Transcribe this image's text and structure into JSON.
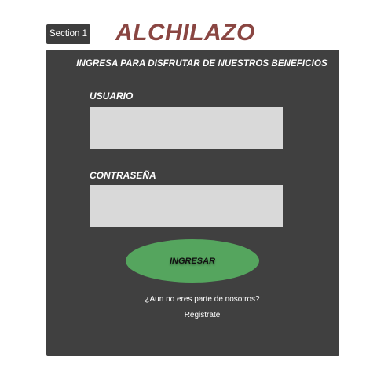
{
  "header": {
    "section_label": "Section 1",
    "brand": "ALCHILAZO"
  },
  "login": {
    "heading": "INGRESA PARA DISFRUTAR DE NUESTROS BENEFICIOS",
    "username_label": "USUARIO",
    "username_value": "",
    "password_label": "CONTRASEÑA",
    "password_value": "",
    "submit_label": "INGRESAR",
    "register_question": "¿Aun no eres parte de nosotros?",
    "register_link": "Registrate"
  },
  "colors": {
    "brand": "#8a4642",
    "panel": "#404040",
    "input": "#d9d9d9",
    "button": "#55a55e"
  }
}
